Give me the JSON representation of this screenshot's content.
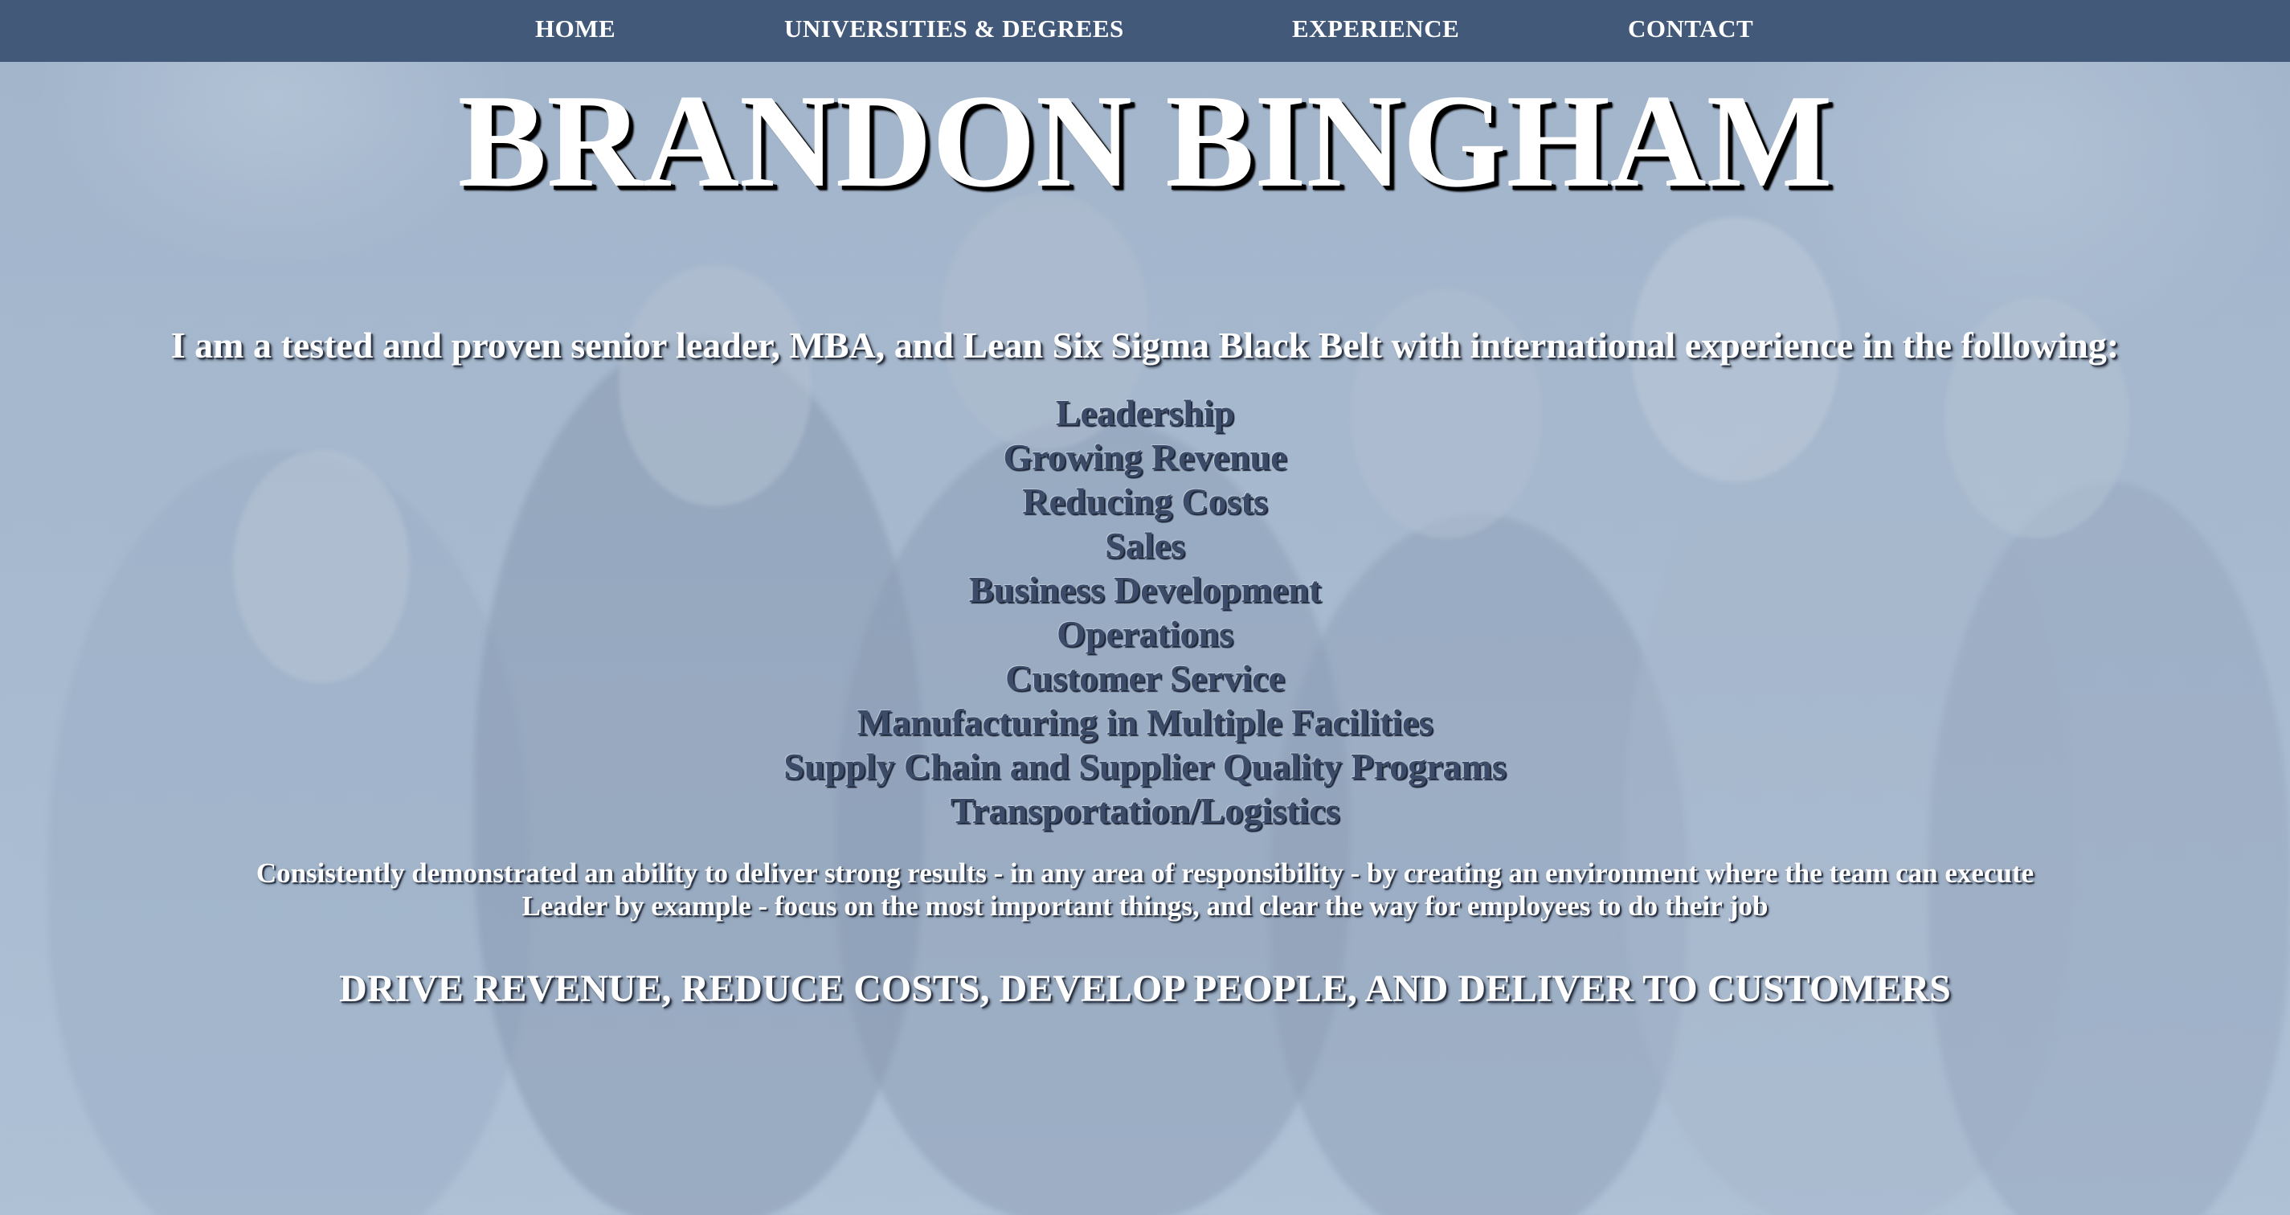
{
  "nav": {
    "items": [
      {
        "label": "HOME"
      },
      {
        "label": "UNIVERSITIES & DEGREES"
      },
      {
        "label": "EXPERIENCE"
      },
      {
        "label": "CONTACT"
      }
    ]
  },
  "hero": {
    "title": "BRANDON BINGHAM",
    "intro": "I am a tested and proven senior leader, MBA, and Lean Six Sigma Black Belt with international experience in the following:",
    "skills": [
      "Leadership",
      "Growing Revenue",
      "Reducing Costs",
      "Sales",
      "Business Development",
      "Operations",
      "Customer Service",
      "Manufacturing in Multiple Facilities",
      "Supply Chain and Supplier Quality Programs",
      "Transportation/Logistics"
    ],
    "summary": [
      "Consistently demonstrated an ability to deliver strong results - in any area of responsibility - by creating an environment where the team can execute",
      "Leader by example - focus on the most important things, and clear the way for employees to do their job"
    ],
    "tagline": "DRIVE REVENUE, REDUCE COSTS, DEVELOP PEOPLE, AND DELIVER TO CUSTOMERS"
  },
  "colors": {
    "nav_background": "#43597a",
    "page_background": "#a6b7cc",
    "skill_text": "#3c4b68",
    "heading_text": "#ffffff"
  }
}
